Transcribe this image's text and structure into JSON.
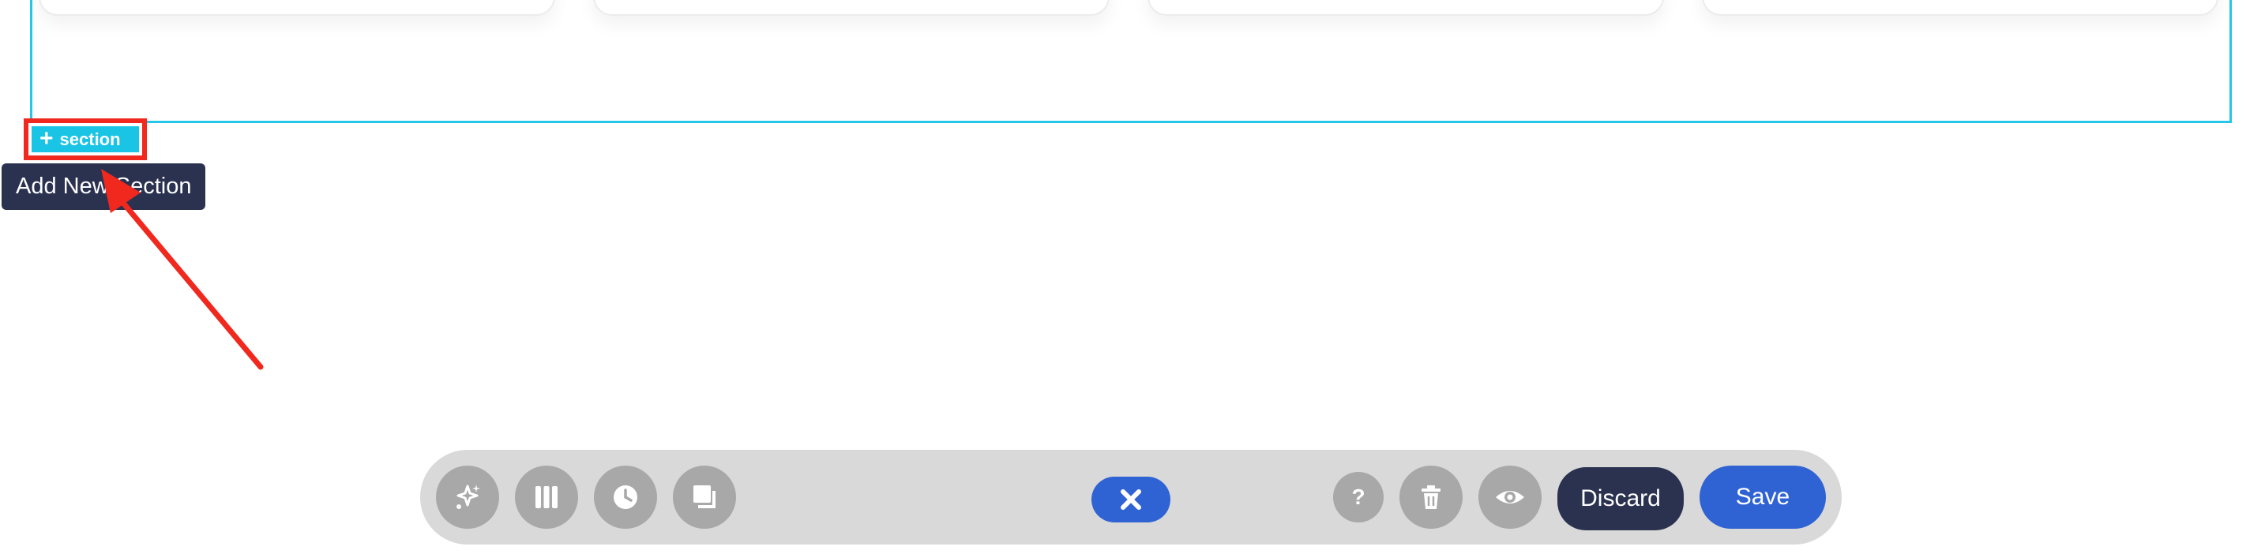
{
  "section_controls": {
    "add_section_label": "section",
    "tooltip": "Add New Section"
  },
  "toolbar": {
    "left_icons": [
      "sparkles-icon",
      "columns-icon",
      "history-icon",
      "layers-icon"
    ],
    "close_icon": "close-icon",
    "right_icons": [
      "help-icon",
      "trash-icon",
      "eye-icon"
    ],
    "discard_label": "Discard",
    "save_label": "Save"
  },
  "colors": {
    "accent_cyan": "#19c4e4",
    "annotation_red": "#f0281e",
    "primary_blue": "#2f63d4",
    "dark_navy": "#2b3250",
    "toolbar_gray": "#d9d9d9",
    "icon_gray": "#a8a8a8"
  }
}
